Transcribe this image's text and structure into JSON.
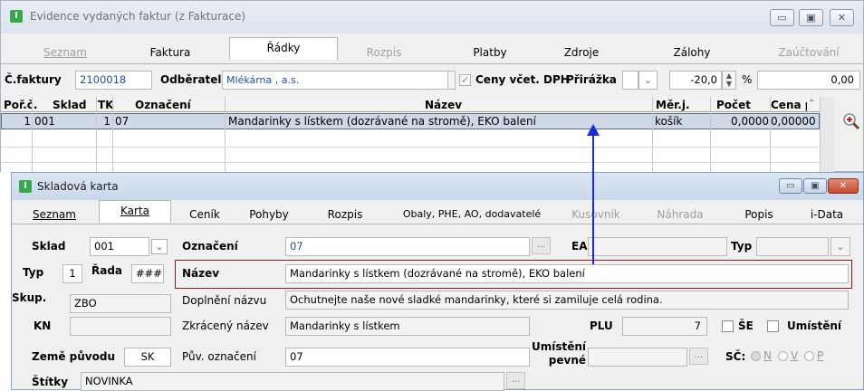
{
  "window_top": {
    "title": "Evidence vydaných faktur (z Fakturace)",
    "app_icon_letter": "I",
    "tabs": [
      {
        "label": "Seznam",
        "state": "disabled"
      },
      {
        "label": "Faktura",
        "state": "normal"
      },
      {
        "label": "Řádky",
        "state": "active"
      },
      {
        "label": "Rozpis",
        "state": "disabled"
      },
      {
        "label": "Platby",
        "state": "normal"
      },
      {
        "label": "Zdroje",
        "state": "normal"
      },
      {
        "label": "Zálohy",
        "state": "normal"
      },
      {
        "label": "Zaúčtování",
        "state": "disabled"
      }
    ],
    "invoice_label": "Č.faktury",
    "invoice_value": "2100018",
    "customer_label": "Odběratel",
    "customer_value": "Mlékárna , a.s.",
    "prices_vat_label": "Ceny včet. DPH",
    "surcharge_label": "Přirážka",
    "surcharge_value": "-20,0",
    "percent_sign": "%",
    "amount_value": "0,00",
    "grid": {
      "headers": [
        "Poř.č.",
        "Sklad",
        "TK",
        "Označení",
        "Název",
        "Měr.j.",
        "Počet",
        "Cena po"
      ],
      "rows": [
        {
          "por": "1",
          "sklad": "001",
          "tk": "1",
          "oznaceni": "07",
          "nazev": "Mandarinky s lístkem (dozrávané na stromě), EKO balení",
          "merj": "košík",
          "pocet": "0,0000",
          "cena": "0,00000"
        }
      ]
    }
  },
  "window_card": {
    "title": "Skladová karta",
    "tabs": [
      {
        "label": "Seznam",
        "state": "normal"
      },
      {
        "label": "Karta",
        "state": "active"
      },
      {
        "label": "Ceník",
        "state": "normal"
      },
      {
        "label": "Pohyby",
        "state": "normal"
      },
      {
        "label": "Rozpis",
        "state": "normal"
      },
      {
        "label": "Obaly, PHE, AO, dodavatelé",
        "state": "normal"
      },
      {
        "label": "Kusovník",
        "state": "disabled"
      },
      {
        "label": "Náhrada",
        "state": "disabled"
      },
      {
        "label": "Popis",
        "state": "normal"
      },
      {
        "label": "i-Data",
        "state": "normal"
      }
    ],
    "fields": {
      "sklad_label": "Sklad",
      "sklad_value": "001",
      "typ_label": "Typ",
      "typ_value": "1",
      "rada_label": "Řada",
      "rada_value": "###",
      "skup_label": "Skup.",
      "skup_value": "ZBO",
      "kn_label": "KN",
      "kn_value": "",
      "zeme_label": "Země původu",
      "zeme_value": "SK",
      "stitky_label": "Štítky",
      "stitky_value": "NOVINKA",
      "oznaceni_label": "Označení",
      "oznaceni_value": "07",
      "nazev_label": "Název",
      "nazev_value": "Mandarinky s lístkem (dozrávané na stromě), EKO balení",
      "doplneni_label": "Doplnění názvu",
      "doplneni_value": "Ochutnejte naše nové sladké mandarinky, které si zamiluje celá rodina.",
      "zkraceny_label": "Zkrácený název",
      "zkraceny_value": "Mandarinky s lístkem",
      "puv_label": "Pův. označení",
      "puv_value": "07",
      "ean_label": "EAN",
      "ean_value": "",
      "typ2_label": "Typ",
      "typ2_value": "",
      "plu_label": "PLU",
      "plu_value": "7",
      "se_label": "ŠE",
      "umisteni_label": "Umístění",
      "umisteni_pevne_label_1": "Umístění",
      "umisteni_pevne_label_2": "pevné",
      "sc_label": "SČ:",
      "sc_options": [
        "N",
        "V",
        "P"
      ],
      "ellipsis": "..."
    }
  },
  "colors": {
    "arrow": "#1c2bd6",
    "highlight_border": "#8b1a1a",
    "selected_row": "#cfd8e6",
    "link_blue": "#1f4fa8"
  }
}
